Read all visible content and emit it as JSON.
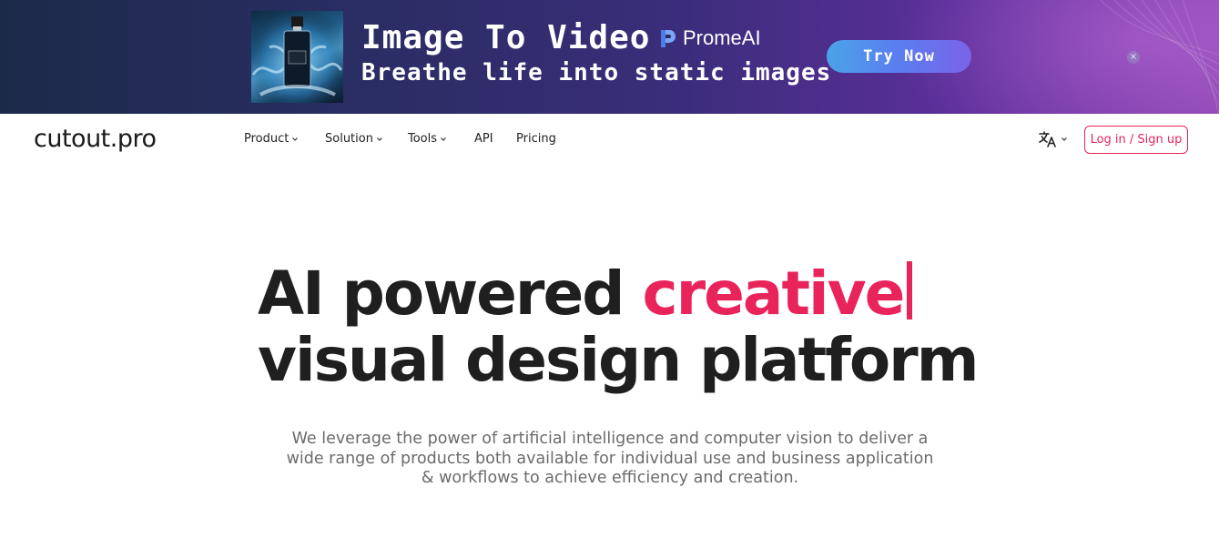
{
  "banner": {
    "title": "Image To Video",
    "subtitle": "Breathe life into static images",
    "brand": "PromeAI",
    "cta": "Try Now",
    "close_glyph": "×",
    "thumbnail_icon": "perfume-bottle-image",
    "colors": {
      "background_start": "#1c2a4a",
      "background_end": "#8c47b1",
      "cta_start": "#4aa3e8",
      "cta_end": "#7a64e6"
    }
  },
  "nav": {
    "logo": "cutout.pro",
    "items": [
      {
        "label": "Product",
        "dropdown": true
      },
      {
        "label": "Solution",
        "dropdown": true
      },
      {
        "label": "Tools",
        "dropdown": true
      },
      {
        "label": "API",
        "dropdown": false
      },
      {
        "label": "Pricing",
        "dropdown": false
      }
    ],
    "language_icon": "translate-icon",
    "login": "Log in / Sign up"
  },
  "hero": {
    "title_part1": "AI powered ",
    "title_accent": "creative",
    "title_line2": "visual design platform",
    "description_lines": [
      "We leverage the power of artificial intelligence and computer vision to deliver a",
      "wide range of products both available for individual use and business application",
      "& workflows to achieve efficiency and creation."
    ],
    "colors": {
      "accent": "#e8245a",
      "heading": "#1f1f1f",
      "body": "#6b6b6b"
    }
  }
}
